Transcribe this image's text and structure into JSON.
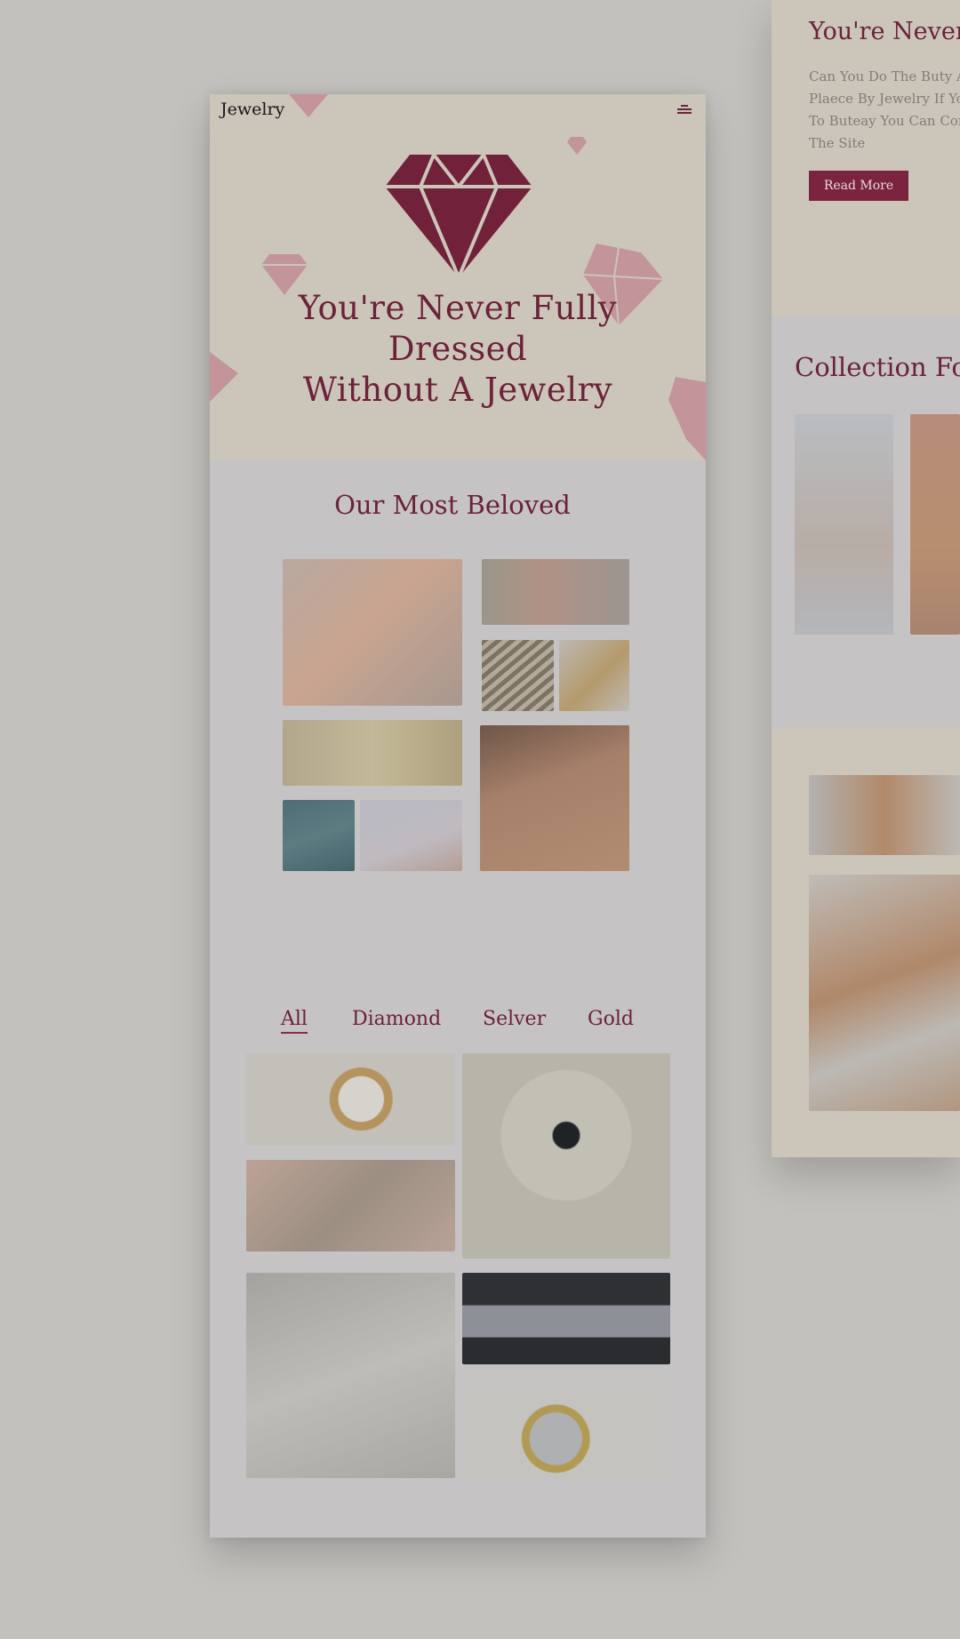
{
  "colors": {
    "accent": "#6c2238",
    "hero_bg": "#cbc5ba",
    "page_bg": "#c3c1bd"
  },
  "header": {
    "brand": "Jewelry",
    "menu_icon": "hamburger-icon"
  },
  "hero": {
    "title_line1": "You're Never Fully Dressed",
    "title_line2": "Without A Jewelry"
  },
  "beloved": {
    "title": "Our Most Beloved"
  },
  "filters": {
    "tabs": [
      "All",
      "Diamond",
      "Selver",
      "Gold"
    ],
    "active": "All"
  },
  "side": {
    "title": "You're Never F",
    "body": "Can You Do The Buty A\nPlaece By Jewelry If Yo\nTo Buteay You Can Cor\nThe Site",
    "button": "Read More",
    "collection_title": "Collection For"
  }
}
